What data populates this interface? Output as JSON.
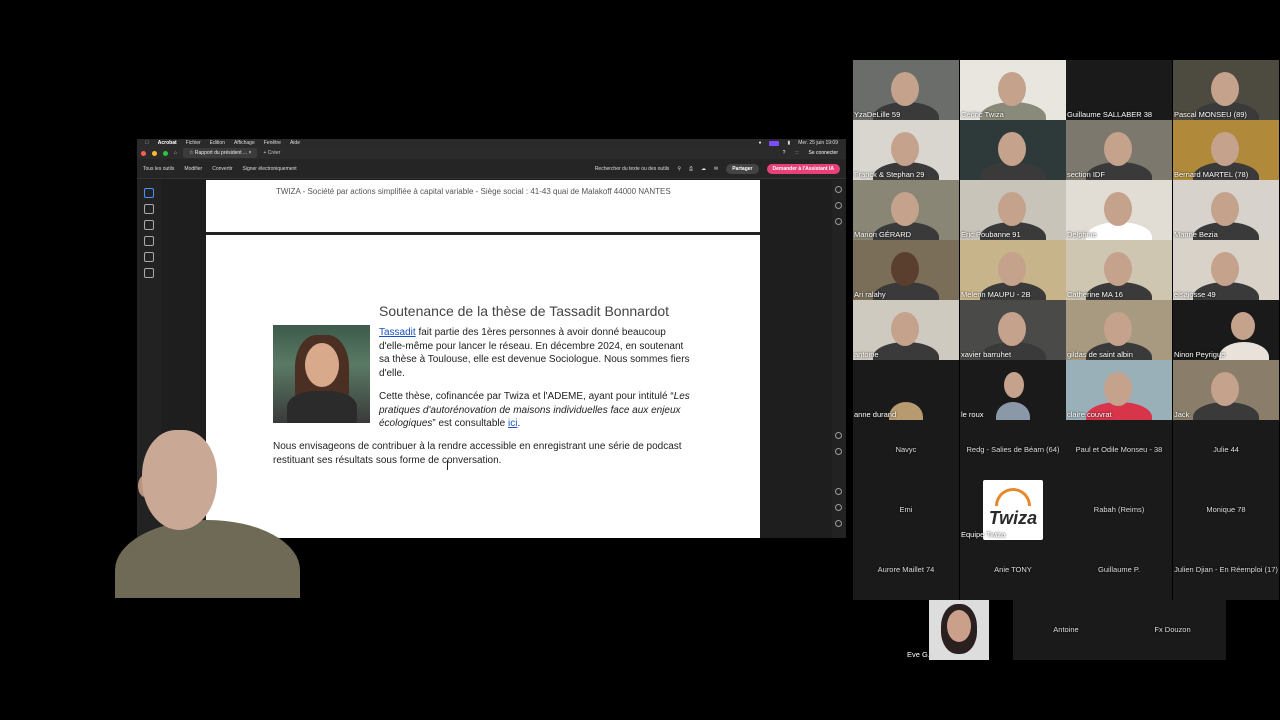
{
  "mac_menu": {
    "app": "Acrobat",
    "items": [
      "Fichier",
      "Edition",
      "Affichage",
      "Fenêtre",
      "Aide"
    ],
    "clock": "Mer. 25 juin 19:09"
  },
  "acrobat": {
    "tab_title": "Rapport du président ...",
    "new_tab": "+ Créer",
    "sign_in": "Se connecter",
    "toolbar": [
      "Tous les outils",
      "Modifier",
      "Convertir",
      "Signer électroniquement"
    ],
    "search_placeholder": "Rechercher du texte ou des outils",
    "share": "Partager",
    "ai_assistant": "Demander à l'Assistant IA"
  },
  "document": {
    "footer_line": "TWIZA - Société par actions simplifiée à capital variable - Siège social : 41-43 quai de Malakoff 44000 NANTES",
    "title": "Soutenance de la thèse de Tassadit Bonnardot",
    "p1_link": "Tassadit",
    "p1_rest": " fait partie des 1ères personnes à avoir donné beaucoup d'elle-même pour lancer le réseau. En décembre 2024, en soutenant sa thèse à Toulouse, elle est devenue Sociologue. Nous sommes fiers d'elle.",
    "p2_start": "Cette thèse, cofinancée par Twiza et l'ADEME, ayant pour intitulé “",
    "p2_italic": "Les pratiques d'autorénovation de maisons individuelles face aux enjeux écologiques",
    "p2_mid": "” est consultable ",
    "p2_link": "ici",
    "p2_end": ".",
    "p3": "Nous envisageons de contribuer à la rendre accessible en enregistrant une série de podcast restituant ses résultats sous forme de conversation."
  },
  "participants": {
    "video": [
      "YzaDeLille 59",
      "Cédric Twiza",
      "Guillaume SALLABER 38",
      "Pascal MONSEU (89)",
      "Franck & Stephan 29",
      "",
      "section IDF",
      "Bernard MARTEL (78)",
      "Marion GÉRARD",
      "Eric Poubanne 91",
      "Delphine",
      "Marine Bezia",
      "Ari ralahy",
      "Melenn MAUPU - 2B",
      "Catherine MA 16",
      "elsajosse 49",
      "antoine",
      "xavier barruhet",
      "gildas de saint albin",
      "Ninon Peyrigue",
      "anne durand",
      "le roux",
      "claire.couvrat",
      "Jack"
    ],
    "audio": [
      "Navyc",
      "Redg - Salies de Béarn (64)",
      "Paul et Odile Monseu - 38",
      "Julie 44",
      "Emi",
      "Equipe Twiza",
      "Rabah (Reims)",
      "Monique  78",
      "Aurore Maillet 74",
      "Anie TONY",
      "Guillaume P.",
      "Julien Djian - En Réemploi (17)"
    ],
    "last_row": [
      "Eve G.",
      "Antoine",
      "Fx Douzon"
    ],
    "logo_text": "Twiza",
    "tile_label": "Twiza"
  }
}
